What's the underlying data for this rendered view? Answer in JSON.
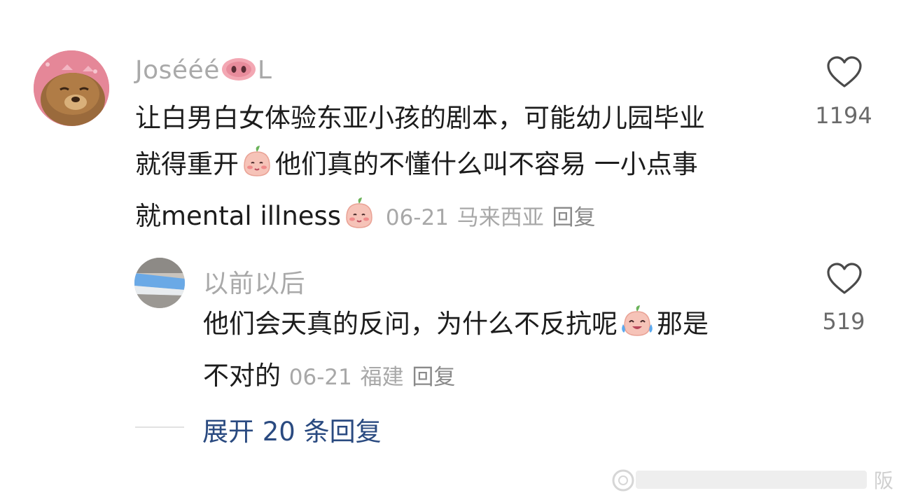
{
  "comments": [
    {
      "username": "Josééé",
      "username_suffix": "L",
      "username_emoji": "pig-nose-emoji",
      "text_lines": [
        "让白男白女体验东亚小孩的剧本，可能幼儿园毕业",
        "就得重开",
        "他们真的不懂什么叫不容易 一小点事",
        "就mental illness"
      ],
      "date": "06-21",
      "location": "马来西亚",
      "reply_label": "回复",
      "likes": "1194",
      "emojis": [
        "blush-peach-emoji",
        "blush-peach-emoji"
      ]
    },
    {
      "username": "以前以后",
      "text_lines": [
        "他们会天真的反问，为什么不反抗呢",
        "那是",
        "不对的"
      ],
      "date": "06-21",
      "location": "福建",
      "reply_label": "回复",
      "likes": "519",
      "emojis": [
        "crying-laugh-peach-emoji"
      ]
    }
  ],
  "expand_replies_label": "展开 20 条回复",
  "icons": {
    "like": "heart-outline-icon"
  },
  "watermark_fragment": "阪",
  "colors": {
    "username": "#a9a9a9",
    "body_text": "#1c1c1c",
    "meta": "#a8a8a8",
    "expand_link": "#2a4a80",
    "like_count": "#6a6a6a"
  }
}
